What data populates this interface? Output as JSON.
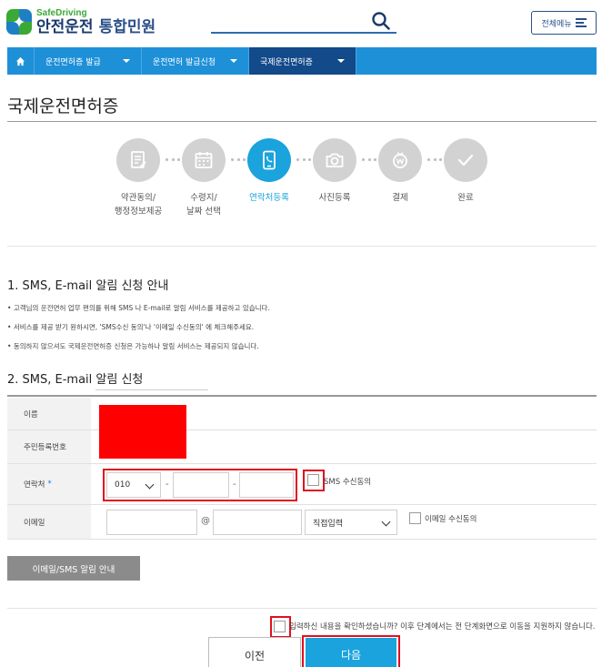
{
  "header": {
    "logo_sub": "SafeDriving",
    "logo_main": "안전운전",
    "logo_service": "통합민원",
    "menu_label": "전체메뉴"
  },
  "nav": {
    "items": [
      {
        "label": "운전면허증 발급"
      },
      {
        "label": "운전면허 발급신청"
      },
      {
        "label": "국제운전면허증"
      }
    ],
    "active_index": 2
  },
  "page": {
    "title": "국제운전면허증"
  },
  "steps": [
    {
      "line1": "약관동의/",
      "line2": "행정정보제공",
      "icon": "document-icon"
    },
    {
      "line1": "수령지/",
      "line2": "날짜 선택",
      "icon": "calendar-icon"
    },
    {
      "line1": "연락처등록",
      "line2": "",
      "icon": "phone-icon",
      "active": true
    },
    {
      "line1": "사진등록",
      "line2": "",
      "icon": "camera-icon"
    },
    {
      "line1": "결제",
      "line2": "",
      "icon": "coin-icon"
    },
    {
      "line1": "완료",
      "line2": "",
      "icon": "check-icon"
    }
  ],
  "section1": {
    "title": "1. SMS, E-mail 알림 신청 안내",
    "bullets": [
      "고객님의 운전면허 업무 편의를 위해 SMS 나 E-mail로 알림 서비스를 제공하고 있습니다.",
      "서비스를 제공 받기 원하시면, 'SMS수신 동의'나 '이메일 수신동의' 에 체크해주세요.",
      "동의하지 않으셔도 국제운전면허증 신청은 가능하나 알림 서비스는 제공되지 않습니다."
    ]
  },
  "section2": {
    "title": "2. SMS, E-mail 알림 신청",
    "labels": {
      "name": "이름",
      "rrn": "주민등록번호",
      "phone": "연락처",
      "required_mark": "*",
      "email": "이메일"
    },
    "phone_prefix": "010",
    "sms_consent": "SMS 수신동의",
    "email_at": "@",
    "email_domain_select": "직접입력",
    "email_consent": "이메일 수신동의",
    "info_button": "이메일/SMS 알림 안내"
  },
  "footer": {
    "confirm_text": "입력하신 내용을 확인하셨습니까? 이후 단계에서는 전 단계화면으로 이동을 지원하지 않습니다.",
    "prev_button": "이전",
    "next_button": "다음"
  },
  "colors": {
    "nav_blue": "#1e90d8",
    "nav_active": "#124a8a",
    "step_active": "#1aa3dc",
    "highlight_red": "#e0101e",
    "redaction": "#ff0000"
  }
}
